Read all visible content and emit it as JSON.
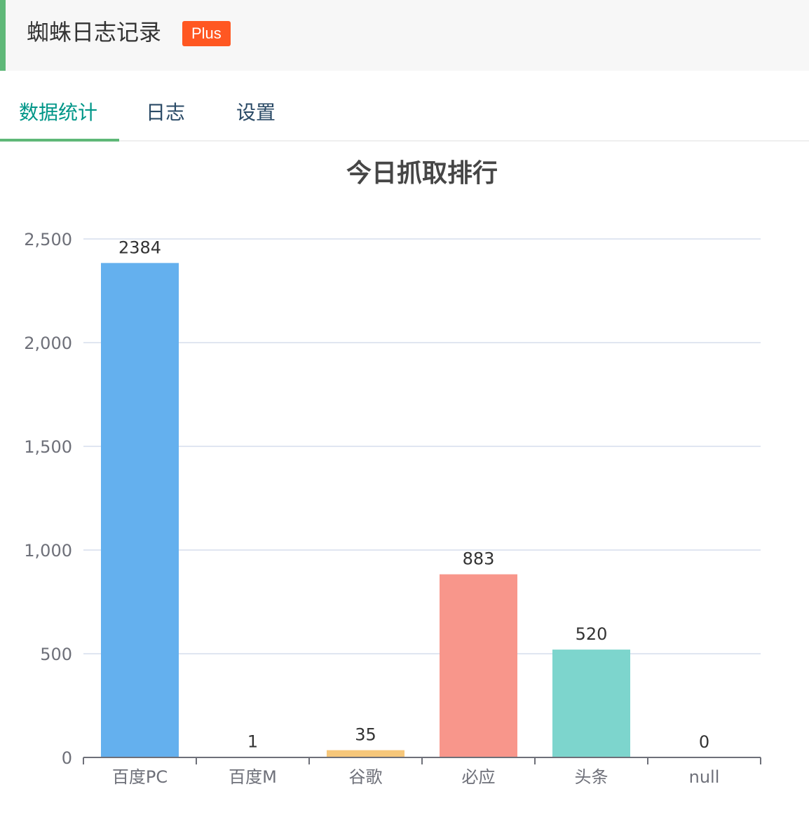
{
  "header": {
    "title": "蜘蛛日志记录",
    "badge": "Plus",
    "accent_color": "#5fb878",
    "badge_color": "#ff5722"
  },
  "tabs": [
    {
      "label": "数据统计",
      "active": true
    },
    {
      "label": "日志",
      "active": false
    },
    {
      "label": "设置",
      "active": false
    }
  ],
  "chart_data": {
    "type": "bar",
    "title": "今日抓取排行",
    "categories": [
      "百度PC",
      "百度M",
      "谷歌",
      "必应",
      "头条",
      "null"
    ],
    "values": [
      2384,
      1,
      35,
      883,
      520,
      0
    ],
    "colors": [
      "#64b0ee",
      "#7ed3f4",
      "#f6c77a",
      "#f8968b",
      "#7dd5cd",
      "#a5b2e6"
    ],
    "ylim": [
      0,
      2500
    ],
    "yticks": [
      0,
      500,
      1000,
      1500,
      2000,
      2500
    ],
    "ytick_labels": [
      "0",
      "500",
      "1,000",
      "1,500",
      "2,000",
      "2,500"
    ],
    "grid": true,
    "xlabel": "",
    "ylabel": ""
  }
}
